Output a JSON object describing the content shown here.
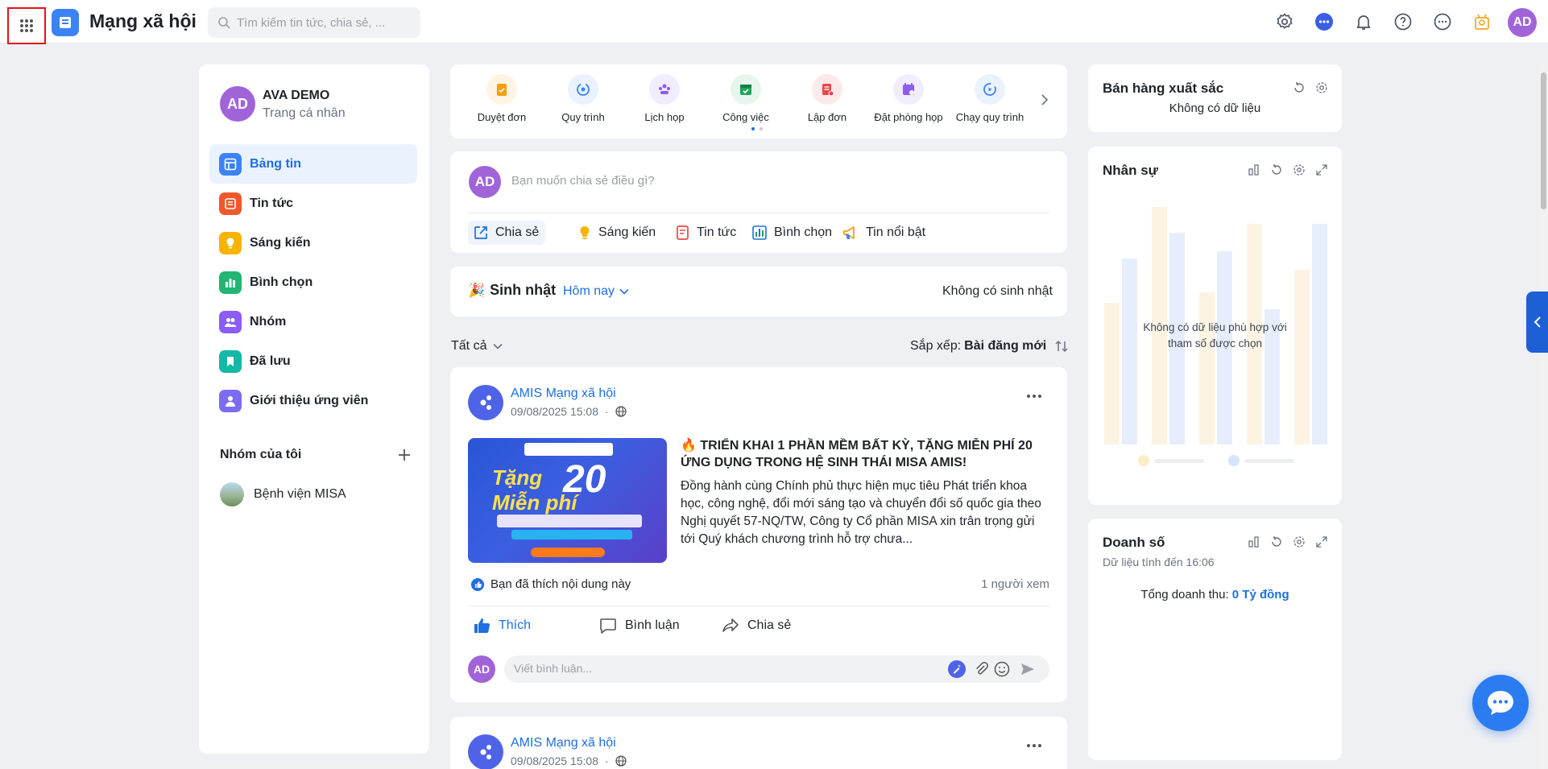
{
  "app": {
    "title": "Mạng xã hội"
  },
  "search": {
    "placeholder": "Tìm kiếm tin tức, chia sẻ, ..."
  },
  "user": {
    "initials": "AD",
    "name": "AVA DEMO",
    "subtitle": "Trang cá nhân"
  },
  "sidebar": {
    "items": [
      {
        "label": "Bảng tin",
        "icon": "news-feed-icon",
        "color": "#3b82f6",
        "active": true
      },
      {
        "label": "Tin tức",
        "icon": "newspaper-icon",
        "color": "#f0582b"
      },
      {
        "label": "Sáng kiến",
        "icon": "lightbulb-icon",
        "color": "#f5b400"
      },
      {
        "label": "Bình chọn",
        "icon": "poll-icon",
        "color": "#22b573"
      },
      {
        "label": "Nhóm",
        "icon": "group-icon",
        "color": "#8b5cf6"
      },
      {
        "label": "Đã lưu",
        "icon": "bookmark-icon",
        "color": "#14b8a6"
      },
      {
        "label": "Giới thiệu ứng viên",
        "icon": "candidate-icon",
        "color": "#7c6cf2"
      }
    ],
    "groups_title": "Nhóm của tôi",
    "groups": [
      {
        "label": "Bệnh viện MISA"
      }
    ]
  },
  "quick_actions": [
    {
      "label": "Duyệt đơn",
      "icon": "approve-form-icon",
      "color": "#f59e0b"
    },
    {
      "label": "Quy trình",
      "icon": "process-icon",
      "color": "#3b82f6"
    },
    {
      "label": "Lịch họp",
      "icon": "meeting-icon",
      "color": "#8b5cf6"
    },
    {
      "label": "Công việc",
      "icon": "task-icon",
      "color": "#22a35a"
    },
    {
      "label": "Lập đơn",
      "icon": "create-form-icon",
      "color": "#ef4444"
    },
    {
      "label": "Đặt phòng họp",
      "icon": "book-room-icon",
      "color": "#8b5cf6"
    },
    {
      "label": "Chạy quy trình",
      "icon": "run-process-icon",
      "color": "#3b82f6"
    }
  ],
  "composer": {
    "placeholder": "Bạn muốn chia sẻ điều gì?",
    "buttons": [
      {
        "label": "Chia sẻ",
        "icon": "share-edit-icon",
        "active": true
      },
      {
        "label": "Sáng kiến",
        "icon": "lightbulb-icon"
      },
      {
        "label": "Tin tức",
        "icon": "newspaper-icon"
      },
      {
        "label": "Bình chọn",
        "icon": "poll-icon"
      },
      {
        "label": "Tin nổi bật",
        "icon": "megaphone-icon"
      }
    ]
  },
  "birthday": {
    "title": "Sinh nhật",
    "filter": "Hôm nay",
    "empty": "Không có sinh nhật"
  },
  "feed": {
    "filter": "Tất cả",
    "sort_label": "Sắp xếp:",
    "sort_value": "Bài đăng mới"
  },
  "post": {
    "author": "AMIS Mạng xã hội",
    "date": "09/08/2025 15:08",
    "headline": "🔥 TRIỂN KHAI 1 PHẦN MỀM BẤT KỲ, TẶNG MIỄN PHÍ 20 ỨNG DỤNG TRONG HỆ SINH THÁI MISA AMIS!",
    "body": "Đồng hành cùng Chính phủ thực hiện mục tiêu Phát triển khoa học, công nghệ, đổi mới sáng tạo và chuyển đổi số quốc gia theo Nghị quyết 57-NQ/TW, Công ty Cổ phần MISA xin trân trọng gửi tới Quý khách chương trình hỗ trợ chưa...",
    "image_text": {
      "tang": "Tặng",
      "mien_phi": "Miễn phí",
      "number": "20"
    },
    "liked_text": "Bạn đã thích nội dung này",
    "views": "1 người xem",
    "actions": {
      "like": "Thích",
      "comment": "Bình luận",
      "share": "Chia sẻ"
    },
    "comment_placeholder": "Viết bình luận..."
  },
  "post2": {
    "author": "AMIS Mạng xã hội",
    "date": "09/08/2025 15:08"
  },
  "widgets": {
    "sales": {
      "title": "Bán hàng xuất sắc",
      "empty": "Không có dữ liệu"
    },
    "hr": {
      "title": "Nhân sự",
      "empty": "Không có dữ liệu phù hợp với tham số được chọn"
    },
    "revenue": {
      "title": "Doanh số",
      "subtitle": "Dữ liệu tính đến 16:06",
      "total_label": "Tổng doanh thu:",
      "total_value": "0 Tỷ đồng"
    }
  },
  "colors": {
    "accent": "#1e6fe0",
    "avatar": "#a064d8"
  }
}
